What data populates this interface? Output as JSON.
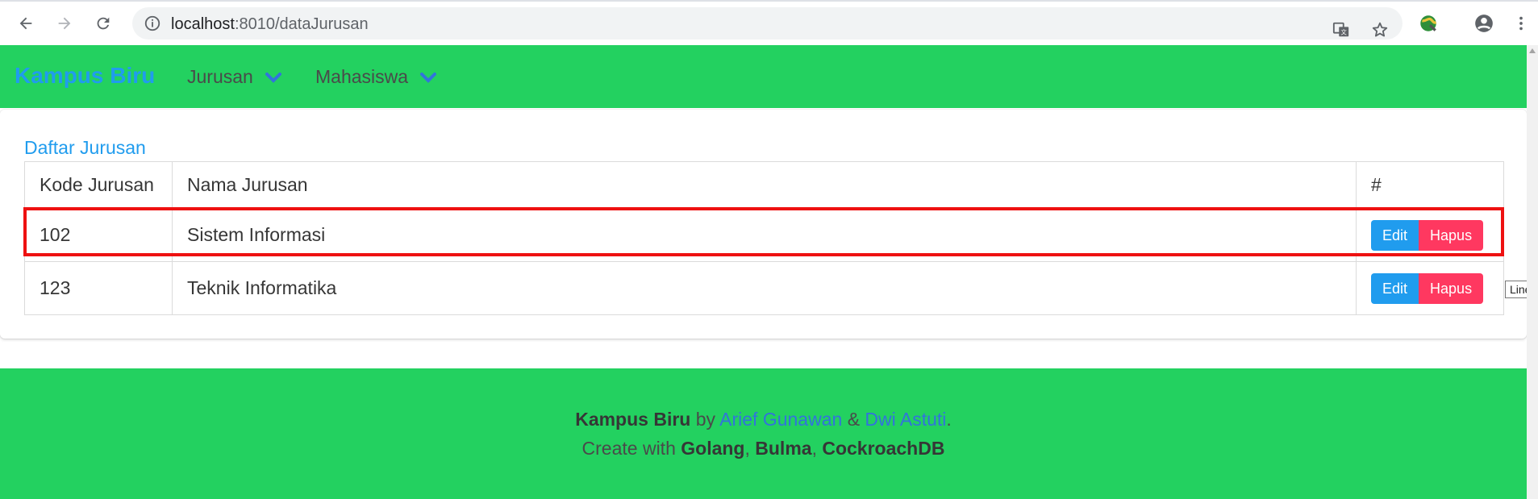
{
  "browser": {
    "url_host": "localhost",
    "url_path": ":8010/dataJurusan"
  },
  "navbar": {
    "brand": "Kampus Biru",
    "menus": [
      {
        "label": "Jurusan"
      },
      {
        "label": "Mahasiswa"
      }
    ]
  },
  "panel": {
    "title": "Daftar Jurusan",
    "columns": [
      "Kode Jurusan",
      "Nama Jurusan",
      "#"
    ],
    "rows": [
      {
        "kode": "102",
        "nama": "Sistem Informasi",
        "edit": "Edit",
        "hapus": "Hapus"
      },
      {
        "kode": "123",
        "nama": "Teknik Informatika",
        "edit": "Edit",
        "hapus": "Hapus"
      }
    ]
  },
  "tooltip": "Line",
  "footer": {
    "brand": "Kampus Biru",
    "by": "by",
    "author1": "Arief Gunawan",
    "amp": "&",
    "author2": "Dwi Astuti",
    "period": ".",
    "create_with": "Create with",
    "tech1": "Golang",
    "tech2": "Bulma",
    "tech3": "CockroachDB",
    "comma": ","
  },
  "colors": {
    "navbar_bg": "#23d160",
    "brand": "#209cee",
    "edit_button": "#209cee",
    "hapus_button": "#ff3860",
    "highlight_border": "#ee1111"
  }
}
